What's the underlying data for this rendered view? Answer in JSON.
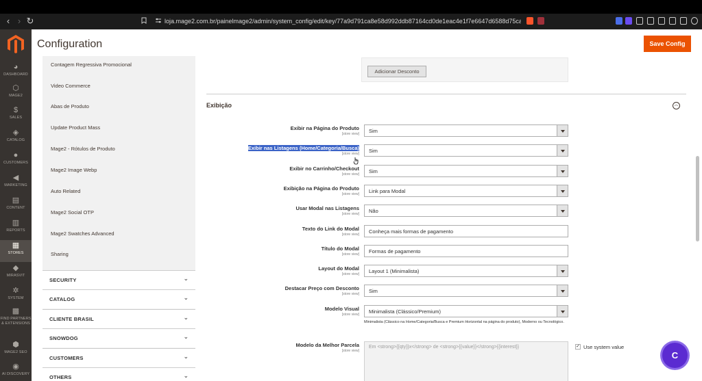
{
  "browser": {
    "url": "loja.mage2.com.br/painelmage2/admin/system_config/edit/key/77a9d791ca8e58d992ddb87164cd0de1eac4e1f7e6647d6588d75ca4c319f0b5/section/ma..."
  },
  "admin_nav": [
    {
      "label": "DASHBOARD",
      "icon": "dashboard-icon",
      "glyph": "◕"
    },
    {
      "label": "MAGE2",
      "icon": "hexagon-icon",
      "glyph": "⬡"
    },
    {
      "label": "SALES",
      "icon": "dollar-icon",
      "glyph": "$"
    },
    {
      "label": "CATALOG",
      "icon": "box-icon",
      "glyph": "◈"
    },
    {
      "label": "CUSTOMERS",
      "icon": "person-icon",
      "glyph": "●"
    },
    {
      "label": "MARKETING",
      "icon": "megaphone-icon",
      "glyph": "◀"
    },
    {
      "label": "CONTENT",
      "icon": "content-icon",
      "glyph": "▤"
    },
    {
      "label": "REPORTS",
      "icon": "bar-chart-icon",
      "glyph": "▥"
    },
    {
      "label": "STORES",
      "icon": "store-icon",
      "glyph": "▦"
    },
    {
      "label": "MIRASVIT",
      "icon": "diamond-icon",
      "glyph": "◆"
    },
    {
      "label": "SYSTEM",
      "icon": "gear-icon",
      "glyph": "✲"
    },
    {
      "label": "FIND PARTNERS & EXTENSIONS",
      "icon": "puzzle-icon",
      "glyph": "▩"
    },
    {
      "label": "MAGE2 SEO",
      "icon": "seo-icon",
      "glyph": "⬢"
    },
    {
      "label": "AI DISCOVERY",
      "icon": "ai-icon",
      "glyph": "◉"
    }
  ],
  "page": {
    "title": "Configuration",
    "save_label": "Save Config"
  },
  "config_sidebar": {
    "links": [
      "Contagem Regressiva Promocional",
      "Video Commerce",
      "Abas de Produto",
      "Update Product Mass",
      "Mage2 - Rótulos de Produto",
      "Mage2 Image Webp",
      "Auto Related",
      "Mage2 Social OTP",
      "Mage2 Swatches Advanced",
      "Sharing"
    ],
    "sections": [
      "SECURITY",
      "CATALOG",
      "CLIENTE BRASIL",
      "SNOWDOG",
      "CUSTOMERS",
      "OTHERS"
    ]
  },
  "main": {
    "add_discount_label": "Adicionar Desconto",
    "group_title": "Exibição",
    "scope_label": "[store view]",
    "rows": [
      {
        "label": "Exibir na Página do Produto",
        "type": "select",
        "value": "Sim"
      },
      {
        "label": "Exibir nas Listagens (Home/Categoria/Busca)",
        "type": "select",
        "value": "Sim"
      },
      {
        "label": "Exibir no Carrinho/Checkout",
        "type": "select",
        "value": "Sim"
      },
      {
        "label": "Exibição na Página do Produto",
        "type": "select",
        "value": "Link para Modal"
      },
      {
        "label": "Usar Modal nas Listagens",
        "type": "select",
        "value": "Não"
      },
      {
        "label": "Texto do Link do Modal",
        "type": "input",
        "value": "Conheça mais formas de pagamento"
      },
      {
        "label": "Título do Modal",
        "type": "input",
        "value": "Formas de pagamento"
      },
      {
        "label": "Layout do Modal",
        "type": "select",
        "value": "Layout 1 (Minimalista)"
      },
      {
        "label": "Destacar Preço com Desconto",
        "type": "select",
        "value": "Sim"
      },
      {
        "label": "Modelo Visual",
        "type": "select",
        "value": "Minimalista (Clássico/Premium)"
      }
    ],
    "visual_note": "Minimalista (Clássico na Home/Categoria/Busca e Premium Horizontal na página do produto), Moderno ou Tecnológico.",
    "best_installment_label": "Modelo da Melhor Parcela",
    "best_installment_value": "Em <strong>{{qty}}x</strong> de <strong>{{value}}</strong>{{interest}}",
    "use_system_value_label": "Use system value"
  },
  "chat_fab_letter": "C"
}
